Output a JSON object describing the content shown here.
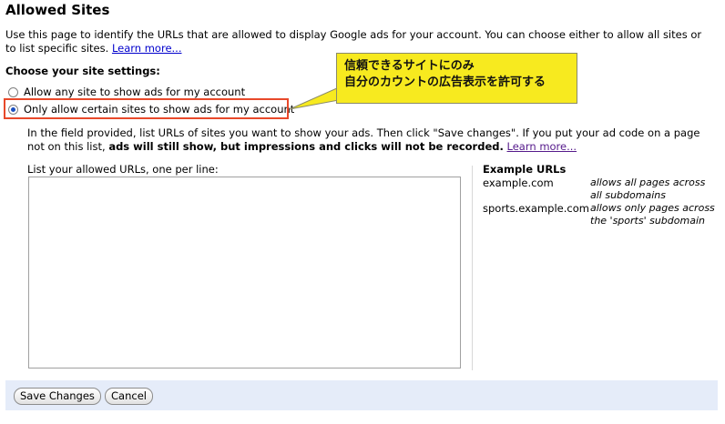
{
  "page": {
    "title": "Allowed Sites",
    "intro_text": "Use this page to identify the URLs that are allowed to display Google ads for your account. You can choose either to allow all sites or to list specific sites. ",
    "intro_link": "Learn more..."
  },
  "settings": {
    "heading": "Choose your site settings:",
    "option_any": "Allow any site to show ads for my account",
    "option_certain": "Only allow certain sites to show ads for my account",
    "selected": "option_certain"
  },
  "callout": {
    "line1": "信頼できるサイトにのみ",
    "line2": "自分のカウントの広告表示を許可する",
    "color": "#f7ea1f"
  },
  "description": {
    "text": "In the field provided, list URLs of sites you want to show your ads. Then click \"Save changes\". If you put your ad code on a page not on this list, ",
    "bold_text": "ads will still show, but impressions and clicks will not be recorded.",
    "link": "Learn more..."
  },
  "urls_field": {
    "label": "List your allowed URLs, one per line:",
    "value": ""
  },
  "examples": {
    "heading": "Example URLs",
    "items": [
      {
        "url": "example.com",
        "desc": "allows all pages across all subdomains"
      },
      {
        "url": "sports.example.com",
        "desc": "allows only pages across the 'sports' subdomain"
      }
    ]
  },
  "footer": {
    "save_label": "Save Changes",
    "cancel_label": "Cancel",
    "background": "#e5ecf9"
  },
  "colors": {
    "highlight_border": "#e8492a",
    "link": "#0000cc",
    "visited_link": "#551a8b"
  }
}
